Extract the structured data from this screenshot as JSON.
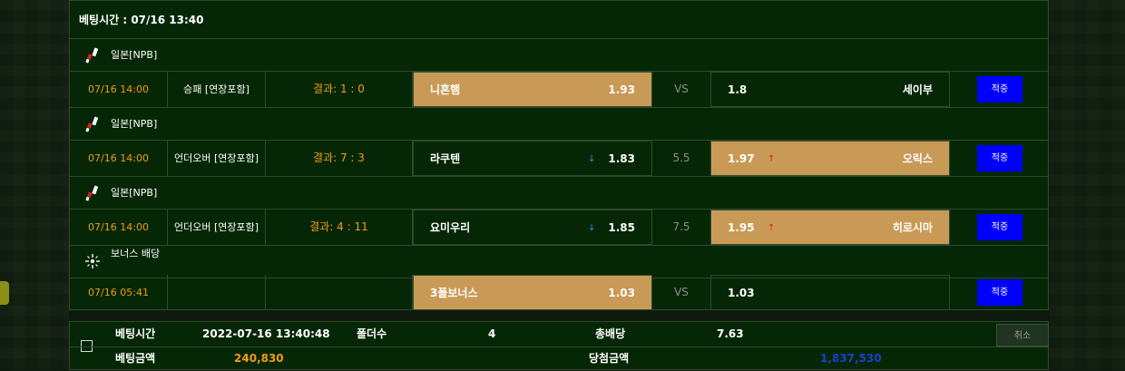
{
  "header": {
    "title": "베팅시간 : 07/16 13:40"
  },
  "groups": [
    {
      "league": "일본[NPB]",
      "time": "07/16 14:00",
      "bet_type": "승패 [연장포함]",
      "result": "결과: 1 : 0",
      "home_team": "니혼햄",
      "home_odds": "1.93",
      "home_arrow": "",
      "middle": "VS",
      "away_odds": "1.8",
      "away_arrow": "",
      "away_team": "세이부",
      "selected": "home",
      "button": "적중"
    },
    {
      "league": "일본[NPB]",
      "time": "07/16 14:00",
      "bet_type": "언더오버 [연장포함]",
      "result": "결과: 7 : 3",
      "home_team": "라쿠텐",
      "home_odds": "1.83",
      "home_arrow": "↓",
      "middle": "5.5",
      "away_odds": "1.97",
      "away_arrow": "↑",
      "away_team": "오릭스",
      "selected": "away",
      "button": "적중"
    },
    {
      "league": "일본[NPB]",
      "time": "07/16 14:00",
      "bet_type": "언더오버 [연장포함]",
      "result": "결과: 4 : 11",
      "home_team": "요미우리",
      "home_odds": "1.85",
      "home_arrow": "↓",
      "middle": "7.5",
      "away_odds": "1.95",
      "away_arrow": "↑",
      "away_team": "히로시마",
      "selected": "away",
      "button": "적중"
    },
    {
      "league": "보너스 배당",
      "time": "07/16 05:41",
      "bet_type": "",
      "result": "",
      "home_team": "3폴보너스",
      "home_odds": "1.03",
      "home_arrow": "",
      "middle": "VS",
      "away_odds": "1.03",
      "away_arrow": "",
      "away_team": "",
      "selected": "home",
      "button": "적중"
    }
  ],
  "summary": {
    "bet_time_label": "베팅시간",
    "bet_time_value": "2022-07-16 13:40:48",
    "folders_label": "폴더수",
    "folders_value": "4",
    "total_odds_label": "총배당",
    "total_odds_value": "7.63",
    "cancel_label": "취소",
    "bet_amount_label": "베팅금액",
    "bet_amount_value": "240,830",
    "win_amount_label": "당첨금액",
    "win_amount_value": "1,837,530"
  },
  "colors": {
    "panel_bg": "#052705",
    "selected_bg": "#c99a56",
    "accent_orange": "#f39c12",
    "button_blue": "#0000ff",
    "arrow_down": "#1e90ff",
    "arrow_up": "#e02020",
    "win_amount": "#1c3fd0"
  },
  "icons": {
    "league": "baseball-bat-icon",
    "bonus": "sparkle-icon"
  }
}
